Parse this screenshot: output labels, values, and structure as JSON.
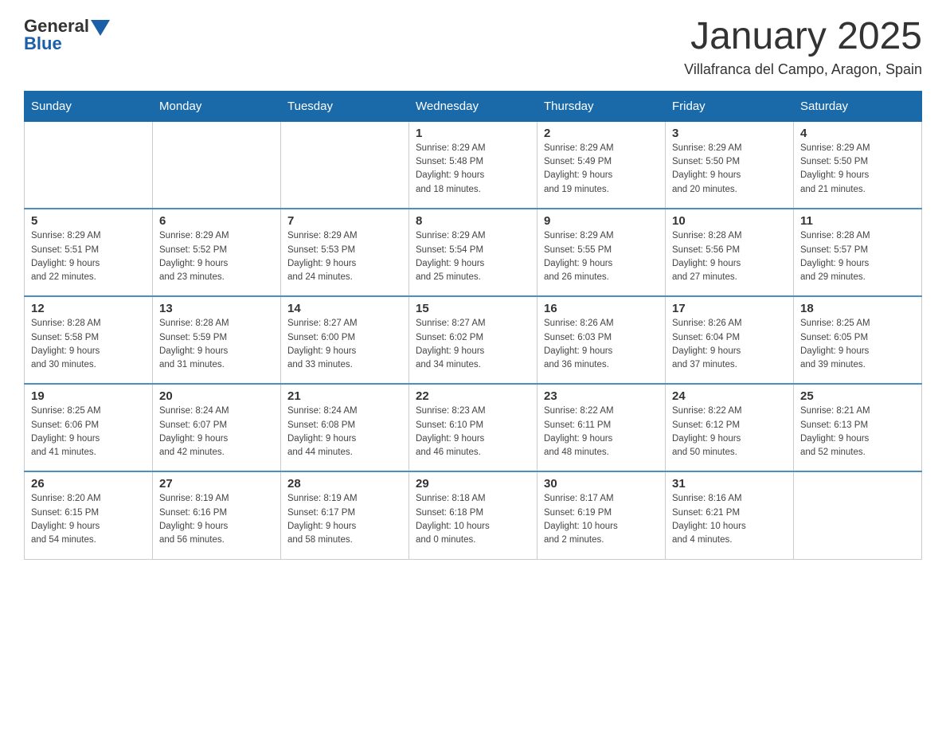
{
  "header": {
    "logo_general": "General",
    "logo_blue": "Blue",
    "title": "January 2025",
    "subtitle": "Villafranca del Campo, Aragon, Spain"
  },
  "days_of_week": [
    "Sunday",
    "Monday",
    "Tuesday",
    "Wednesday",
    "Thursday",
    "Friday",
    "Saturday"
  ],
  "weeks": [
    [
      {
        "day": "",
        "info": ""
      },
      {
        "day": "",
        "info": ""
      },
      {
        "day": "",
        "info": ""
      },
      {
        "day": "1",
        "info": "Sunrise: 8:29 AM\nSunset: 5:48 PM\nDaylight: 9 hours\nand 18 minutes."
      },
      {
        "day": "2",
        "info": "Sunrise: 8:29 AM\nSunset: 5:49 PM\nDaylight: 9 hours\nand 19 minutes."
      },
      {
        "day": "3",
        "info": "Sunrise: 8:29 AM\nSunset: 5:50 PM\nDaylight: 9 hours\nand 20 minutes."
      },
      {
        "day": "4",
        "info": "Sunrise: 8:29 AM\nSunset: 5:50 PM\nDaylight: 9 hours\nand 21 minutes."
      }
    ],
    [
      {
        "day": "5",
        "info": "Sunrise: 8:29 AM\nSunset: 5:51 PM\nDaylight: 9 hours\nand 22 minutes."
      },
      {
        "day": "6",
        "info": "Sunrise: 8:29 AM\nSunset: 5:52 PM\nDaylight: 9 hours\nand 23 minutes."
      },
      {
        "day": "7",
        "info": "Sunrise: 8:29 AM\nSunset: 5:53 PM\nDaylight: 9 hours\nand 24 minutes."
      },
      {
        "day": "8",
        "info": "Sunrise: 8:29 AM\nSunset: 5:54 PM\nDaylight: 9 hours\nand 25 minutes."
      },
      {
        "day": "9",
        "info": "Sunrise: 8:29 AM\nSunset: 5:55 PM\nDaylight: 9 hours\nand 26 minutes."
      },
      {
        "day": "10",
        "info": "Sunrise: 8:28 AM\nSunset: 5:56 PM\nDaylight: 9 hours\nand 27 minutes."
      },
      {
        "day": "11",
        "info": "Sunrise: 8:28 AM\nSunset: 5:57 PM\nDaylight: 9 hours\nand 29 minutes."
      }
    ],
    [
      {
        "day": "12",
        "info": "Sunrise: 8:28 AM\nSunset: 5:58 PM\nDaylight: 9 hours\nand 30 minutes."
      },
      {
        "day": "13",
        "info": "Sunrise: 8:28 AM\nSunset: 5:59 PM\nDaylight: 9 hours\nand 31 minutes."
      },
      {
        "day": "14",
        "info": "Sunrise: 8:27 AM\nSunset: 6:00 PM\nDaylight: 9 hours\nand 33 minutes."
      },
      {
        "day": "15",
        "info": "Sunrise: 8:27 AM\nSunset: 6:02 PM\nDaylight: 9 hours\nand 34 minutes."
      },
      {
        "day": "16",
        "info": "Sunrise: 8:26 AM\nSunset: 6:03 PM\nDaylight: 9 hours\nand 36 minutes."
      },
      {
        "day": "17",
        "info": "Sunrise: 8:26 AM\nSunset: 6:04 PM\nDaylight: 9 hours\nand 37 minutes."
      },
      {
        "day": "18",
        "info": "Sunrise: 8:25 AM\nSunset: 6:05 PM\nDaylight: 9 hours\nand 39 minutes."
      }
    ],
    [
      {
        "day": "19",
        "info": "Sunrise: 8:25 AM\nSunset: 6:06 PM\nDaylight: 9 hours\nand 41 minutes."
      },
      {
        "day": "20",
        "info": "Sunrise: 8:24 AM\nSunset: 6:07 PM\nDaylight: 9 hours\nand 42 minutes."
      },
      {
        "day": "21",
        "info": "Sunrise: 8:24 AM\nSunset: 6:08 PM\nDaylight: 9 hours\nand 44 minutes."
      },
      {
        "day": "22",
        "info": "Sunrise: 8:23 AM\nSunset: 6:10 PM\nDaylight: 9 hours\nand 46 minutes."
      },
      {
        "day": "23",
        "info": "Sunrise: 8:22 AM\nSunset: 6:11 PM\nDaylight: 9 hours\nand 48 minutes."
      },
      {
        "day": "24",
        "info": "Sunrise: 8:22 AM\nSunset: 6:12 PM\nDaylight: 9 hours\nand 50 minutes."
      },
      {
        "day": "25",
        "info": "Sunrise: 8:21 AM\nSunset: 6:13 PM\nDaylight: 9 hours\nand 52 minutes."
      }
    ],
    [
      {
        "day": "26",
        "info": "Sunrise: 8:20 AM\nSunset: 6:15 PM\nDaylight: 9 hours\nand 54 minutes."
      },
      {
        "day": "27",
        "info": "Sunrise: 8:19 AM\nSunset: 6:16 PM\nDaylight: 9 hours\nand 56 minutes."
      },
      {
        "day": "28",
        "info": "Sunrise: 8:19 AM\nSunset: 6:17 PM\nDaylight: 9 hours\nand 58 minutes."
      },
      {
        "day": "29",
        "info": "Sunrise: 8:18 AM\nSunset: 6:18 PM\nDaylight: 10 hours\nand 0 minutes."
      },
      {
        "day": "30",
        "info": "Sunrise: 8:17 AM\nSunset: 6:19 PM\nDaylight: 10 hours\nand 2 minutes."
      },
      {
        "day": "31",
        "info": "Sunrise: 8:16 AM\nSunset: 6:21 PM\nDaylight: 10 hours\nand 4 minutes."
      },
      {
        "day": "",
        "info": ""
      }
    ]
  ]
}
